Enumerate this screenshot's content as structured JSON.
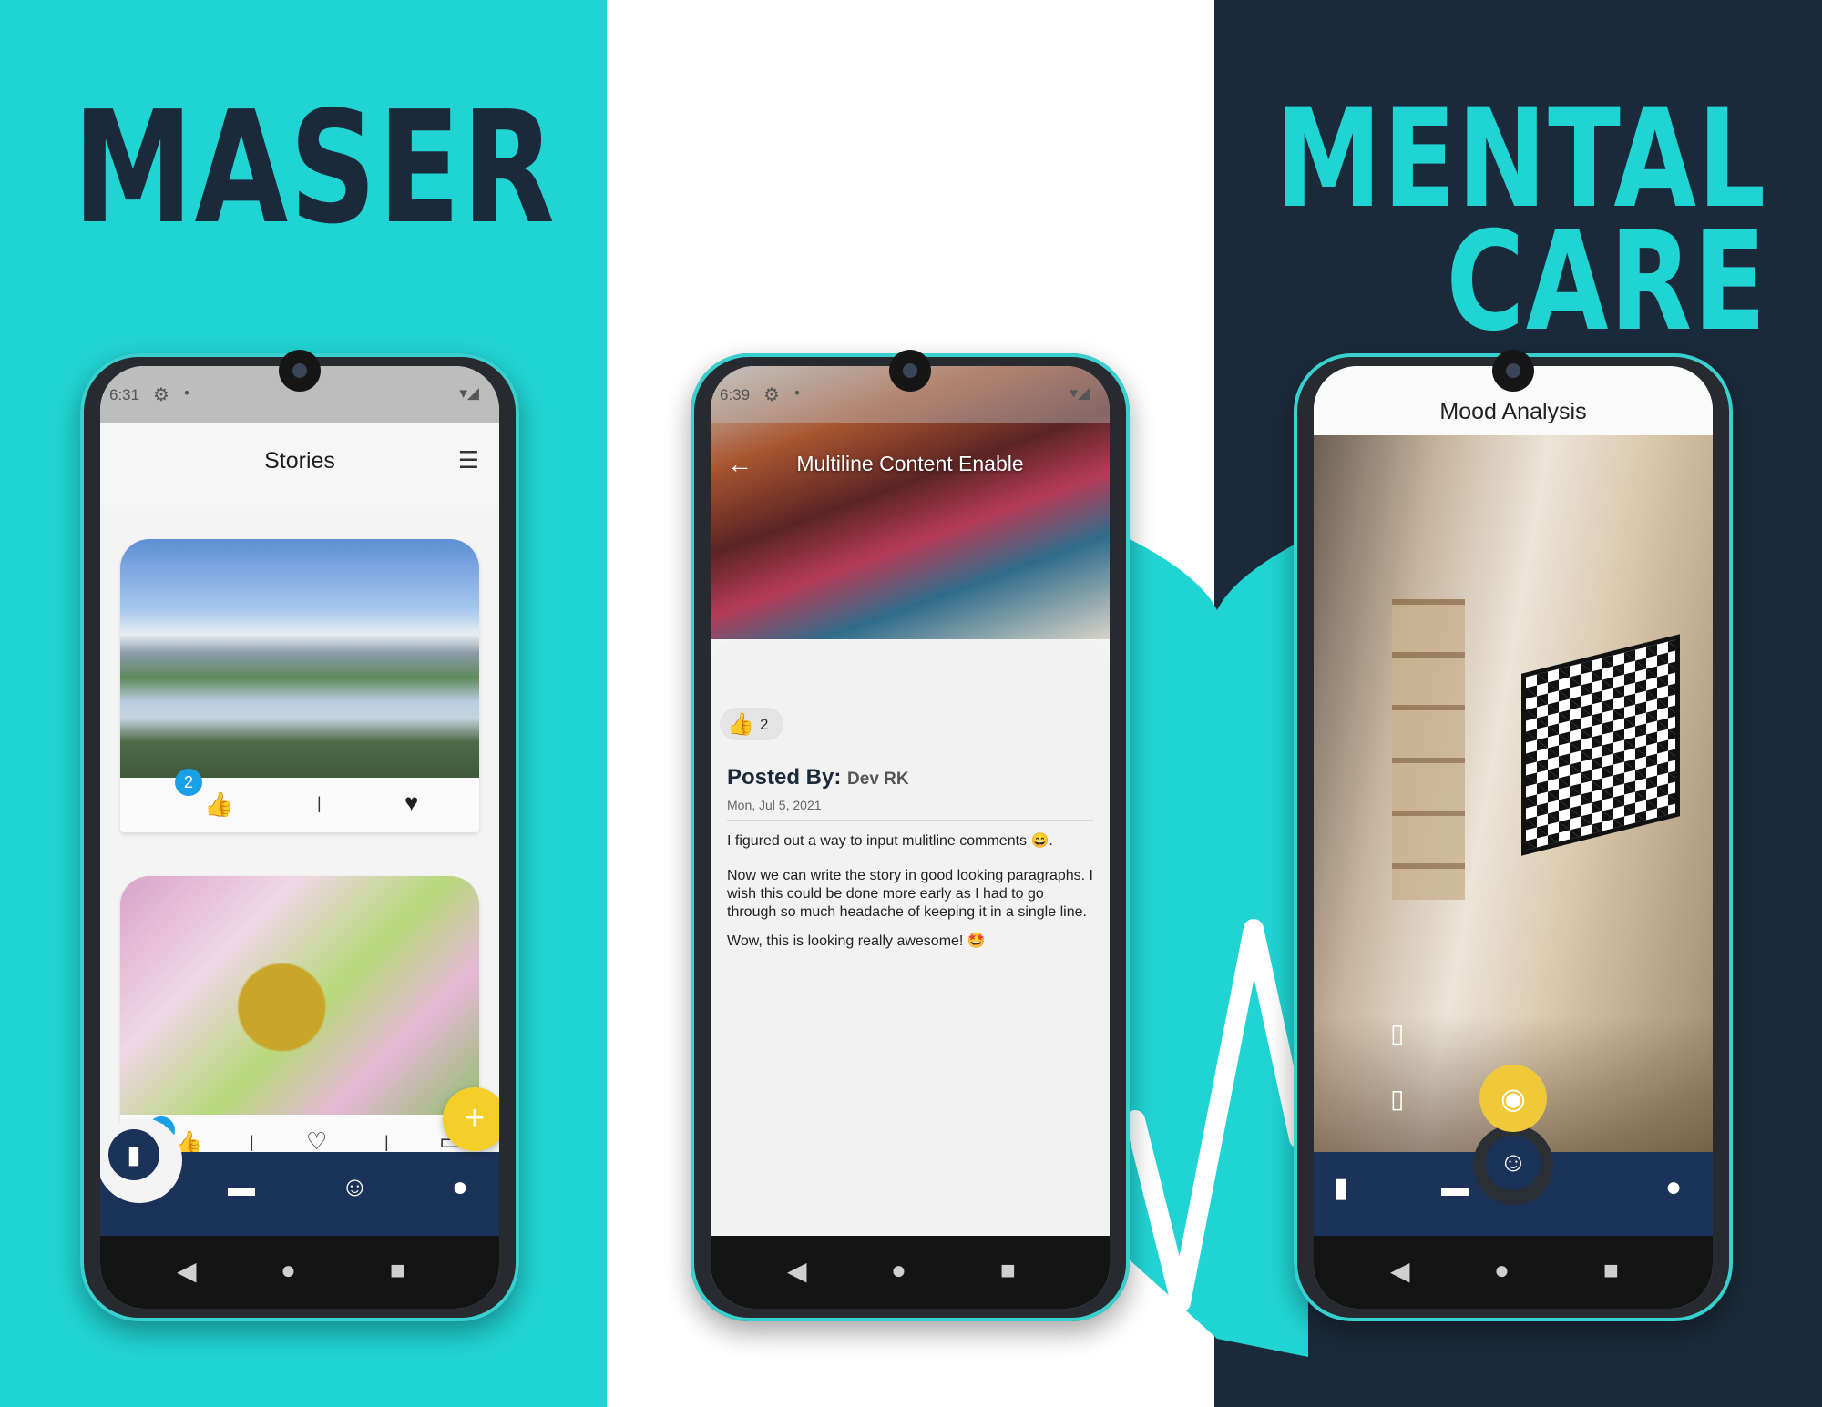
{
  "titles": {
    "left": "MASER",
    "right_line1": "MENTAL",
    "right_line2": "CARE"
  },
  "colors": {
    "teal": "#21d4d4",
    "navy": "#1b2a3a",
    "appbar_navy": "#1b3358",
    "fab_yellow": "#f4cf2a",
    "badge_blue": "#1aa0e6"
  },
  "phone1": {
    "status_time": "6:31",
    "title": "Stories",
    "card1": {
      "likes": "2"
    },
    "card2": {
      "likes": "2"
    },
    "separator": "|",
    "fab_label": "+"
  },
  "phone2": {
    "status_time": "6:39",
    "title": "Multiline Content Enable",
    "likes": "2",
    "posted_by_label": "Posted By:",
    "author": "Dev RK",
    "date": "Mon, Jul 5, 2021",
    "paragraphs": [
      "I figured out a way to input mulitline comments 😄.",
      "Now we can write the story in good looking paragraphs. I wish this could be done more early as I had to go through so much headache of keeping it in a single line.",
      "Wow, this is looking really awesome! 🤩"
    ]
  },
  "phone3": {
    "title": "Mood Analysis"
  },
  "icons": {
    "gear": "⚙",
    "wifi": "▾◢",
    "menu": "☰",
    "thumb": "👍",
    "heart": "♥",
    "heart_outline": "♡",
    "comment": "▭",
    "stories": "▮",
    "chat": "▬",
    "smile": "☺",
    "person": "●",
    "back_arrow": "←",
    "nav_back": "◀",
    "nav_home": "●",
    "nav_recent": "■",
    "camera": "◉",
    "switch": "▯"
  }
}
